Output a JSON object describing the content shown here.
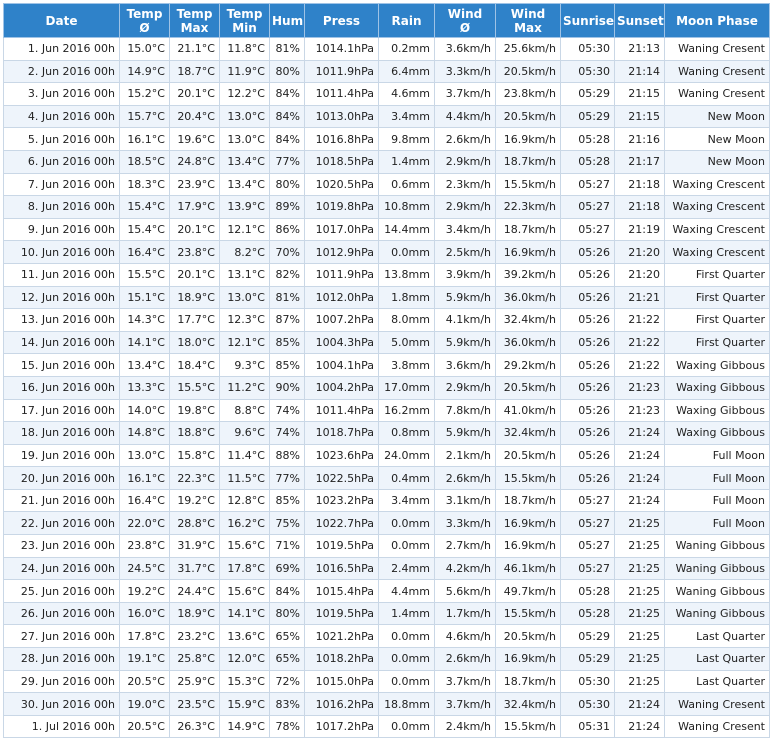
{
  "headers": [
    {
      "l1": "Date",
      "l2": ""
    },
    {
      "l1": "Temp",
      "l2": "Ø"
    },
    {
      "l1": "Temp",
      "l2": "Max"
    },
    {
      "l1": "Temp",
      "l2": "Min"
    },
    {
      "l1": "Hum",
      "l2": ""
    },
    {
      "l1": "Press",
      "l2": ""
    },
    {
      "l1": "Rain",
      "l2": ""
    },
    {
      "l1": "Wind",
      "l2": "Ø"
    },
    {
      "l1": "Wind",
      "l2": "Max"
    },
    {
      "l1": "Sunrise",
      "l2": ""
    },
    {
      "l1": "Sunset",
      "l2": ""
    },
    {
      "l1": "Moon Phase",
      "l2": ""
    }
  ],
  "rows": [
    [
      "1. Jun 2016 00h",
      "15.0°C",
      "21.1°C",
      "11.8°C",
      "81%",
      "1014.1hPa",
      "0.2mm",
      "3.6km/h",
      "25.6km/h",
      "05:30",
      "21:13",
      "Waning Cresent"
    ],
    [
      "2. Jun 2016 00h",
      "14.9°C",
      "18.7°C",
      "11.9°C",
      "80%",
      "1011.9hPa",
      "6.4mm",
      "3.3km/h",
      "20.5km/h",
      "05:30",
      "21:14",
      "Waning Cresent"
    ],
    [
      "3. Jun 2016 00h",
      "15.2°C",
      "20.1°C",
      "12.2°C",
      "84%",
      "1011.4hPa",
      "4.6mm",
      "3.7km/h",
      "23.8km/h",
      "05:29",
      "21:15",
      "Waning Cresent"
    ],
    [
      "4. Jun 2016 00h",
      "15.7°C",
      "20.4°C",
      "13.0°C",
      "84%",
      "1013.0hPa",
      "3.4mm",
      "4.4km/h",
      "20.5km/h",
      "05:29",
      "21:15",
      "New Moon"
    ],
    [
      "5. Jun 2016 00h",
      "16.1°C",
      "19.6°C",
      "13.0°C",
      "84%",
      "1016.8hPa",
      "9.8mm",
      "2.6km/h",
      "16.9km/h",
      "05:28",
      "21:16",
      "New Moon"
    ],
    [
      "6. Jun 2016 00h",
      "18.5°C",
      "24.8°C",
      "13.4°C",
      "77%",
      "1018.5hPa",
      "1.4mm",
      "2.9km/h",
      "18.7km/h",
      "05:28",
      "21:17",
      "New Moon"
    ],
    [
      "7. Jun 2016 00h",
      "18.3°C",
      "23.9°C",
      "13.4°C",
      "80%",
      "1020.5hPa",
      "0.6mm",
      "2.3km/h",
      "15.5km/h",
      "05:27",
      "21:18",
      "Waxing Crescent"
    ],
    [
      "8. Jun 2016 00h",
      "15.4°C",
      "17.9°C",
      "13.9°C",
      "89%",
      "1019.8hPa",
      "10.8mm",
      "2.9km/h",
      "22.3km/h",
      "05:27",
      "21:18",
      "Waxing Crescent"
    ],
    [
      "9. Jun 2016 00h",
      "15.4°C",
      "20.1°C",
      "12.1°C",
      "86%",
      "1017.0hPa",
      "14.4mm",
      "3.4km/h",
      "18.7km/h",
      "05:27",
      "21:19",
      "Waxing Crescent"
    ],
    [
      "10. Jun 2016 00h",
      "16.4°C",
      "23.8°C",
      "8.2°C",
      "70%",
      "1012.9hPa",
      "0.0mm",
      "2.5km/h",
      "16.9km/h",
      "05:26",
      "21:20",
      "Waxing Crescent"
    ],
    [
      "11. Jun 2016 00h",
      "15.5°C",
      "20.1°C",
      "13.1°C",
      "82%",
      "1011.9hPa",
      "13.8mm",
      "3.9km/h",
      "39.2km/h",
      "05:26",
      "21:20",
      "First Quarter"
    ],
    [
      "12. Jun 2016 00h",
      "15.1°C",
      "18.9°C",
      "13.0°C",
      "81%",
      "1012.0hPa",
      "1.8mm",
      "5.9km/h",
      "36.0km/h",
      "05:26",
      "21:21",
      "First Quarter"
    ],
    [
      "13. Jun 2016 00h",
      "14.3°C",
      "17.7°C",
      "12.3°C",
      "87%",
      "1007.2hPa",
      "8.0mm",
      "4.1km/h",
      "32.4km/h",
      "05:26",
      "21:22",
      "First Quarter"
    ],
    [
      "14. Jun 2016 00h",
      "14.1°C",
      "18.0°C",
      "12.1°C",
      "85%",
      "1004.3hPa",
      "5.0mm",
      "5.9km/h",
      "36.0km/h",
      "05:26",
      "21:22",
      "First Quarter"
    ],
    [
      "15. Jun 2016 00h",
      "13.4°C",
      "18.4°C",
      "9.3°C",
      "85%",
      "1004.1hPa",
      "3.8mm",
      "3.6km/h",
      "29.2km/h",
      "05:26",
      "21:22",
      "Waxing Gibbous"
    ],
    [
      "16. Jun 2016 00h",
      "13.3°C",
      "15.5°C",
      "11.2°C",
      "90%",
      "1004.2hPa",
      "17.0mm",
      "2.9km/h",
      "20.5km/h",
      "05:26",
      "21:23",
      "Waxing Gibbous"
    ],
    [
      "17. Jun 2016 00h",
      "14.0°C",
      "19.8°C",
      "8.8°C",
      "74%",
      "1011.4hPa",
      "16.2mm",
      "7.8km/h",
      "41.0km/h",
      "05:26",
      "21:23",
      "Waxing Gibbous"
    ],
    [
      "18. Jun 2016 00h",
      "14.8°C",
      "18.8°C",
      "9.6°C",
      "74%",
      "1018.7hPa",
      "0.8mm",
      "5.9km/h",
      "32.4km/h",
      "05:26",
      "21:24",
      "Waxing Gibbous"
    ],
    [
      "19. Jun 2016 00h",
      "13.0°C",
      "15.8°C",
      "11.4°C",
      "88%",
      "1023.6hPa",
      "24.0mm",
      "2.1km/h",
      "20.5km/h",
      "05:26",
      "21:24",
      "Full Moon"
    ],
    [
      "20. Jun 2016 00h",
      "16.1°C",
      "22.3°C",
      "11.5°C",
      "77%",
      "1022.5hPa",
      "0.4mm",
      "2.6km/h",
      "15.5km/h",
      "05:26",
      "21:24",
      "Full Moon"
    ],
    [
      "21. Jun 2016 00h",
      "16.4°C",
      "19.2°C",
      "12.8°C",
      "85%",
      "1023.2hPa",
      "3.4mm",
      "3.1km/h",
      "18.7km/h",
      "05:27",
      "21:24",
      "Full Moon"
    ],
    [
      "22. Jun 2016 00h",
      "22.0°C",
      "28.8°C",
      "16.2°C",
      "75%",
      "1022.7hPa",
      "0.0mm",
      "3.3km/h",
      "16.9km/h",
      "05:27",
      "21:25",
      "Full Moon"
    ],
    [
      "23. Jun 2016 00h",
      "23.8°C",
      "31.9°C",
      "15.6°C",
      "71%",
      "1019.5hPa",
      "0.0mm",
      "2.7km/h",
      "16.9km/h",
      "05:27",
      "21:25",
      "Waning Gibbous"
    ],
    [
      "24. Jun 2016 00h",
      "24.5°C",
      "31.7°C",
      "17.8°C",
      "69%",
      "1016.5hPa",
      "2.4mm",
      "4.2km/h",
      "46.1km/h",
      "05:27",
      "21:25",
      "Waning Gibbous"
    ],
    [
      "25. Jun 2016 00h",
      "19.2°C",
      "24.4°C",
      "15.6°C",
      "84%",
      "1015.4hPa",
      "4.4mm",
      "5.6km/h",
      "49.7km/h",
      "05:28",
      "21:25",
      "Waning Gibbous"
    ],
    [
      "26. Jun 2016 00h",
      "16.0°C",
      "18.9°C",
      "14.1°C",
      "80%",
      "1019.5hPa",
      "1.4mm",
      "1.7km/h",
      "15.5km/h",
      "05:28",
      "21:25",
      "Waning Gibbous"
    ],
    [
      "27. Jun 2016 00h",
      "17.8°C",
      "23.2°C",
      "13.6°C",
      "65%",
      "1021.2hPa",
      "0.0mm",
      "4.6km/h",
      "20.5km/h",
      "05:29",
      "21:25",
      "Last Quarter"
    ],
    [
      "28. Jun 2016 00h",
      "19.1°C",
      "25.8°C",
      "12.0°C",
      "65%",
      "1018.2hPa",
      "0.0mm",
      "2.6km/h",
      "16.9km/h",
      "05:29",
      "21:25",
      "Last Quarter"
    ],
    [
      "29. Jun 2016 00h",
      "20.5°C",
      "25.9°C",
      "15.3°C",
      "72%",
      "1015.0hPa",
      "0.0mm",
      "3.7km/h",
      "18.7km/h",
      "05:30",
      "21:25",
      "Last Quarter"
    ],
    [
      "30. Jun 2016 00h",
      "19.0°C",
      "23.5°C",
      "15.9°C",
      "83%",
      "1016.2hPa",
      "18.8mm",
      "3.7km/h",
      "32.4km/h",
      "05:30",
      "21:24",
      "Waning Cresent"
    ],
    [
      "1. Jul 2016 00h",
      "20.5°C",
      "26.3°C",
      "14.9°C",
      "78%",
      "1017.2hPa",
      "0.0mm",
      "2.4km/h",
      "15.5km/h",
      "05:31",
      "21:24",
      "Waning Cresent"
    ]
  ]
}
